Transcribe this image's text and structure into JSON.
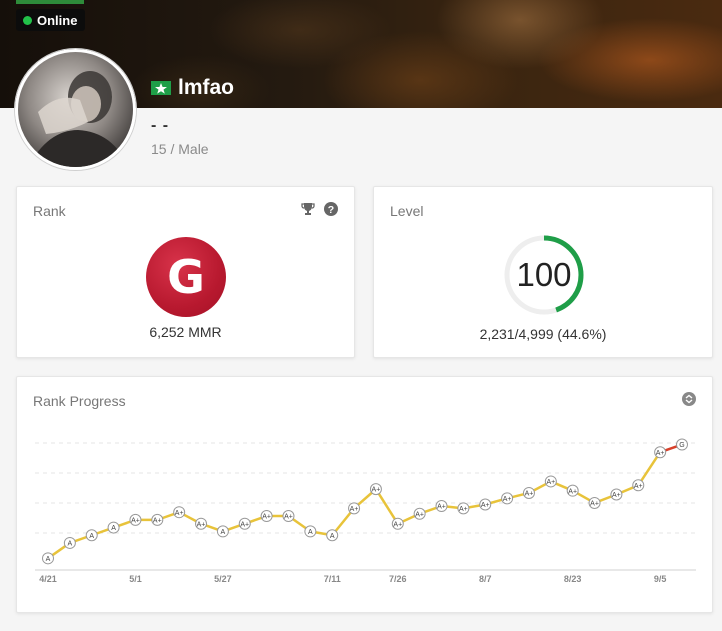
{
  "profile": {
    "status": "Online",
    "username": "lmfao",
    "real_name": "- -",
    "age_gender": "15 / Male"
  },
  "rank": {
    "title": "Rank",
    "badge": "G",
    "mmr": "6,252 MMR"
  },
  "level": {
    "title": "Level",
    "value": "100",
    "xp": "2,231/4,999 (44.6%)",
    "progress": 0.446
  },
  "rank_progress": {
    "title": "Rank Progress"
  },
  "chart_data": {
    "type": "line",
    "x_tick_labels": [
      "4/21",
      "5/1",
      "5/27",
      "7/11",
      "7/26",
      "8/7",
      "8/23",
      "9/5"
    ],
    "points": [
      {
        "label": "A",
        "value": 1
      },
      {
        "label": "A",
        "value": 3
      },
      {
        "label": "A",
        "value": 4
      },
      {
        "label": "A",
        "value": 5
      },
      {
        "label": "A+",
        "value": 6
      },
      {
        "label": "A+",
        "value": 6
      },
      {
        "label": "A+",
        "value": 7
      },
      {
        "label": "A+",
        "value": 5.5
      },
      {
        "label": "A",
        "value": 4.5
      },
      {
        "label": "A+",
        "value": 5.5
      },
      {
        "label": "A+",
        "value": 6.5
      },
      {
        "label": "A+",
        "value": 6.5
      },
      {
        "label": "A",
        "value": 4.5
      },
      {
        "label": "A",
        "value": 4
      },
      {
        "label": "A+",
        "value": 7.5
      },
      {
        "label": "A+",
        "value": 10
      },
      {
        "label": "A+",
        "value": 5.5
      },
      {
        "label": "A+",
        "value": 6.8
      },
      {
        "label": "A+",
        "value": 7.8
      },
      {
        "label": "A+",
        "value": 7.5
      },
      {
        "label": "A+",
        "value": 8
      },
      {
        "label": "A+",
        "value": 8.8
      },
      {
        "label": "A+",
        "value": 9.5
      },
      {
        "label": "A+",
        "value": 11
      },
      {
        "label": "A+",
        "value": 9.8
      },
      {
        "label": "A+",
        "value": 8.2
      },
      {
        "label": "A+",
        "value": 9.3
      },
      {
        "label": "A+",
        "value": 10.5
      },
      {
        "label": "A+",
        "value": 14.8
      },
      {
        "label": "G",
        "value": 15.8
      }
    ],
    "line_color": "#e8c33a",
    "final_segment_color": "#d8402a",
    "grid": true
  }
}
